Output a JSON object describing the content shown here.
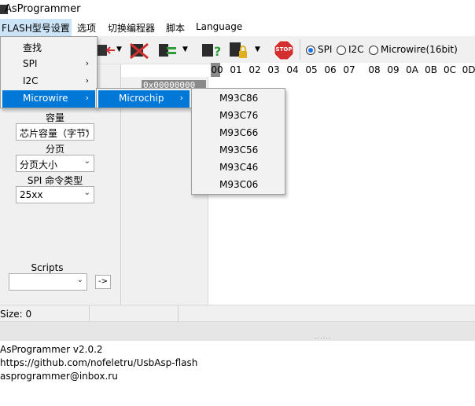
{
  "window": {
    "title": "AsProgrammer"
  },
  "menubar": {
    "items": [
      "FLASH型号设置",
      "选项",
      "切换编程器",
      "脚本",
      "Language"
    ]
  },
  "toolbar": {
    "icons": [
      "chip-read-icon",
      "chip-write-icon",
      "chip-erase-icon",
      "chip-verify-icon",
      "chip-check-icon",
      "chip-lock-icon",
      "stop-icon"
    ],
    "stop_label": "STOP",
    "protocols": [
      {
        "label": "SPI",
        "selected": true
      },
      {
        "label": "I2C",
        "selected": false
      },
      {
        "label": "Microwire(16bit)",
        "selected": false
      }
    ]
  },
  "hex": {
    "columns": [
      "00",
      "01",
      "02",
      "03",
      "04",
      "05",
      "06",
      "07",
      "08",
      "09",
      "0A",
      "0B",
      "0C",
      "0D"
    ],
    "address_value": "0x00000000"
  },
  "leftpanel": {
    "capacity_label": "容量",
    "capacity_value": "芯片容量（字节）",
    "page_label": "分页",
    "page_value": "分页大小",
    "spi_cmd_label": "SPI 命令类型",
    "spi_cmd_value": "25xx",
    "scripts_label": "Scripts",
    "scripts_value": "",
    "run_button": "->"
  },
  "status": {
    "size_text": "Size: 0"
  },
  "log": {
    "lines": [
      "AsProgrammer v2.0.2",
      "https://github.com/nofeletru/UsbAsp-flash",
      "asprogrammer@inbox.ru"
    ]
  },
  "menu_flash": {
    "items": [
      {
        "label": "查找",
        "submenu": false
      },
      {
        "label": "SPI",
        "submenu": true
      },
      {
        "label": "I2C",
        "submenu": true
      },
      {
        "label": "Microwire",
        "submenu": true,
        "highlighted": true
      }
    ]
  },
  "menu_microwire": {
    "items": [
      {
        "label": "Microchip",
        "submenu": true,
        "highlighted": true
      }
    ]
  },
  "menu_microchip": {
    "items": [
      "M93C86",
      "M93C76",
      "M93C66",
      "M93C56",
      "M93C46",
      "M93C06"
    ]
  },
  "colors": {
    "highlight": "#0078d7",
    "stop": "#d32f2f",
    "accent_green": "#2e9d3a"
  }
}
